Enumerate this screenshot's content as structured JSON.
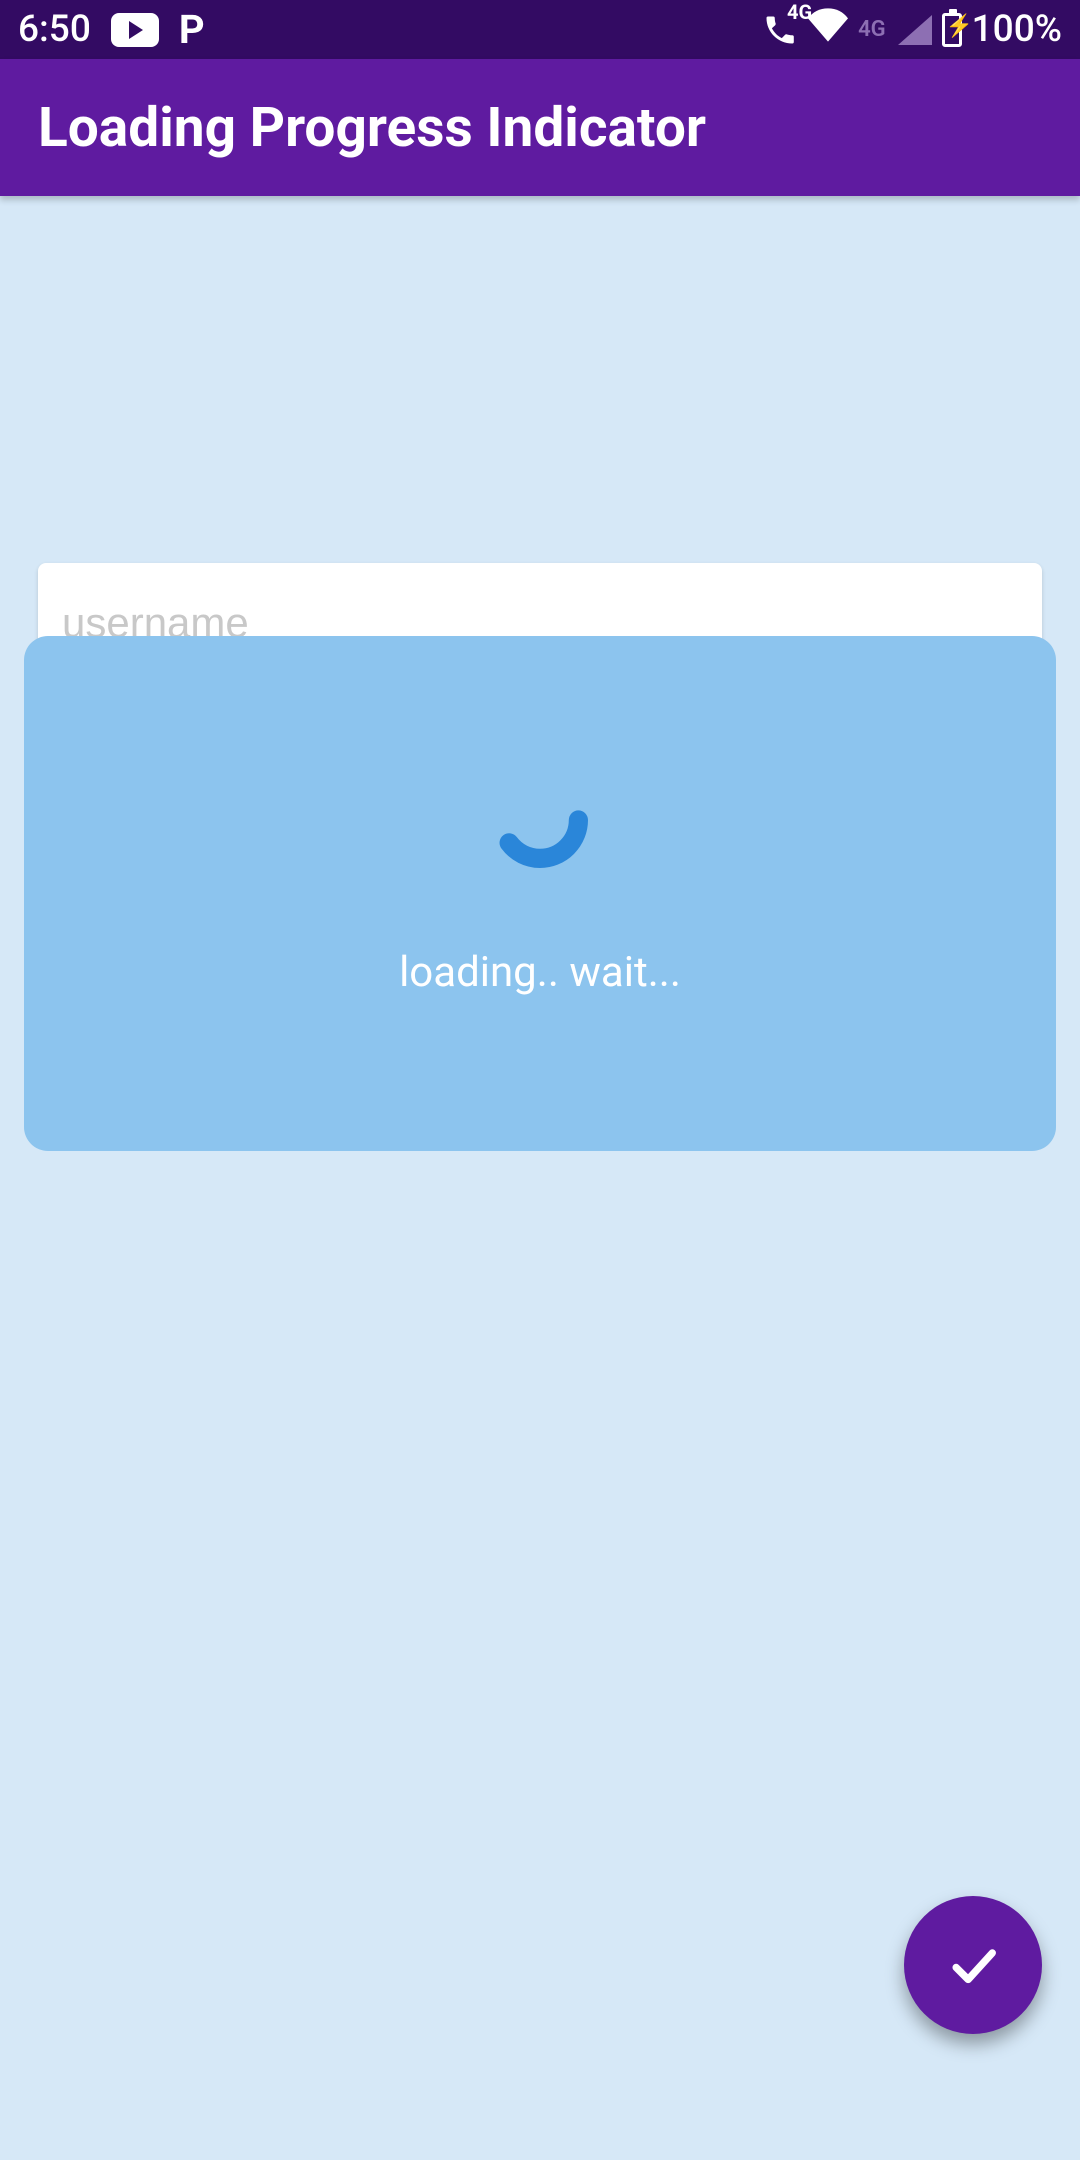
{
  "status": {
    "time": "6:50",
    "left_icons": {
      "youtube": "youtube-icon",
      "pandora": "P"
    },
    "right": {
      "phone_label": "4G",
      "signal_label": "4G",
      "battery_pct": "100%"
    }
  },
  "appbar": {
    "title": "Loading Progress Indicator"
  },
  "form": {
    "username_placeholder": "username",
    "username_value": ""
  },
  "dialog": {
    "visible": true,
    "message": "loading.. wait..."
  },
  "fab": {
    "icon": "check-icon",
    "aria": "Submit"
  },
  "colors": {
    "statusbar": "#330b63",
    "appbar": "#5f1ba0",
    "background": "#d6e8f7",
    "dialog": "#8cc4ee",
    "spinner": "#2a86d9"
  }
}
